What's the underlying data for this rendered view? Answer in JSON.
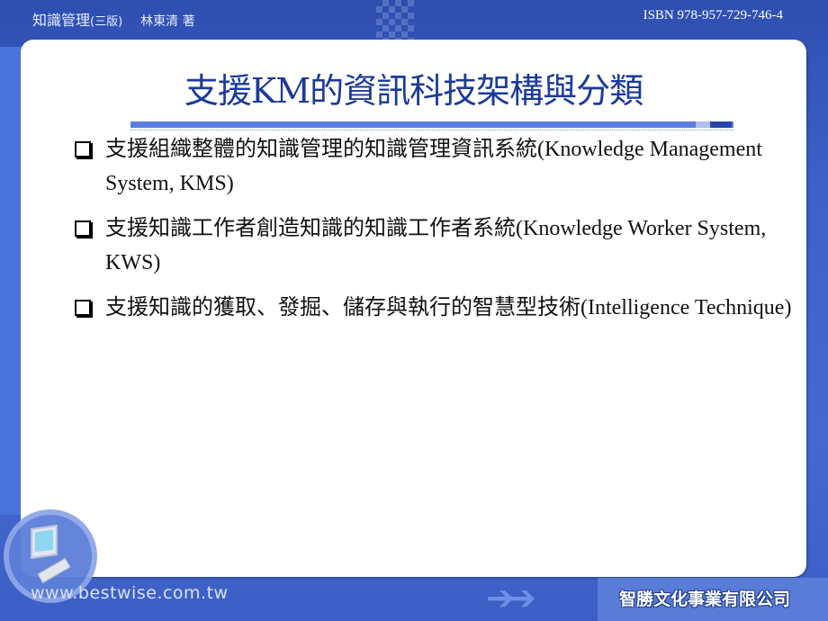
{
  "header": {
    "book_title": "知識管理",
    "edition": "(三版)",
    "author": "林東清 著",
    "isbn": "ISBN 978-957-729-746-4"
  },
  "slide": {
    "title": "支援KM的資訊科技架構與分類",
    "bullets": [
      {
        "text": "支援組織整體的知識管理的知識管理資訊系統(Knowledge Management System, KMS)"
      },
      {
        "text": "支援知識工作者創造知識的知識工作者系統(Knowledge Worker System, KWS)"
      },
      {
        "text": "支援知識的獲取、發掘、儲存與執行的智慧型技術(Intelligence Technique)"
      }
    ],
    "bullet_icon": "hollow-square-icon"
  },
  "footer": {
    "url": "www.bestwise.com.tw",
    "publisher": "智勝文化事業有限公司",
    "logo_icon": "computer-monitor-icon",
    "arrow_icon": "double-arrow-icon"
  },
  "colors": {
    "frame_blue": "#3f64c9",
    "title_blue": "#1b3a9a",
    "text": "#111111"
  }
}
